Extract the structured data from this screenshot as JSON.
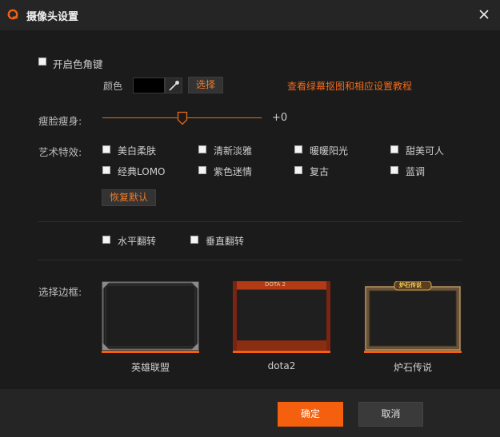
{
  "window": {
    "title": "摄像头设置"
  },
  "chroma": {
    "enable_label": "开启色角键",
    "color_label": "颜色",
    "select_button": "选择",
    "tutorial_link": "查看绿幕抠图和相应设置教程",
    "swatch_color": "#000000"
  },
  "slim": {
    "label": "瘦脸瘦身:",
    "value_text": "+0",
    "level": 0.5
  },
  "effects": {
    "label": "艺术特效:",
    "items": [
      "美白柔肤",
      "清新淡雅",
      "暖暖阳光",
      "甜美可人",
      "经典LOMO",
      "紫色迷情",
      "复古",
      "蓝调"
    ],
    "reset_button": "恢复默认"
  },
  "flip": {
    "horizontal": "水平翻转",
    "vertical": "垂直翻转"
  },
  "frames": {
    "label": "选择边框:",
    "items": [
      "英雄联盟",
      "dota2",
      "炉石传说"
    ],
    "dota_badge": "DOTA 2",
    "hs_badge": "炉石传说"
  },
  "footer": {
    "ok": "确定",
    "cancel": "取消"
  },
  "colors": {
    "accent": "#f5600f",
    "background": "#1b1b1b",
    "titlebar": "#252525"
  }
}
